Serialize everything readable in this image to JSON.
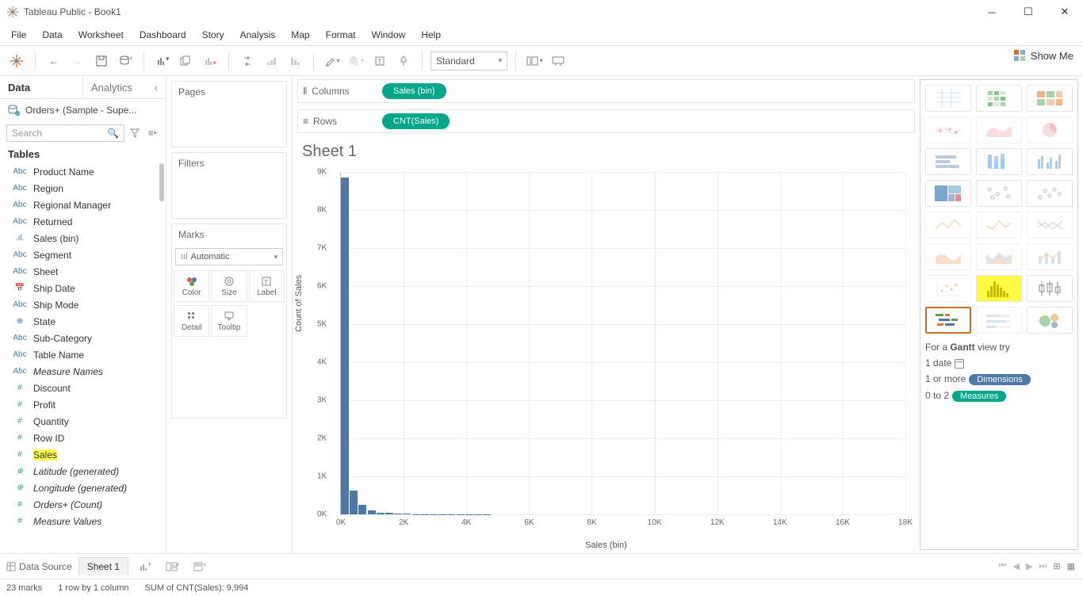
{
  "window": {
    "title": "Tableau Public - Book1"
  },
  "menu": [
    "File",
    "Data",
    "Worksheet",
    "Dashboard",
    "Story",
    "Analysis",
    "Map",
    "Format",
    "Window",
    "Help"
  ],
  "toolbar": {
    "fit": "Standard"
  },
  "show_me_label": "Show Me",
  "side_tabs": {
    "data": "Data",
    "analytics": "Analytics"
  },
  "datasource": "Orders+ (Sample - Supe...",
  "search_placeholder": "Search",
  "tables_label": "Tables",
  "fields": [
    {
      "icon": "Abc",
      "cls": "dim",
      "label": "Product Name"
    },
    {
      "icon": "Abc",
      "cls": "dim",
      "label": "Region"
    },
    {
      "icon": "Abc",
      "cls": "dim",
      "label": "Regional Manager"
    },
    {
      "icon": "Abc",
      "cls": "dim",
      "label": "Returned"
    },
    {
      "icon": ".ıl.",
      "cls": "dim",
      "label": "Sales (bin)"
    },
    {
      "icon": "Abc",
      "cls": "dim",
      "label": "Segment"
    },
    {
      "icon": "Abc",
      "cls": "dim",
      "label": "Sheet"
    },
    {
      "icon": "📅",
      "cls": "dim",
      "label": "Ship Date"
    },
    {
      "icon": "Abc",
      "cls": "dim",
      "label": "Ship Mode"
    },
    {
      "icon": "⊕",
      "cls": "dim",
      "label": "State"
    },
    {
      "icon": "Abc",
      "cls": "dim",
      "label": "Sub-Category"
    },
    {
      "icon": "Abc",
      "cls": "dim",
      "label": "Table Name"
    },
    {
      "icon": "Abc",
      "cls": "dim",
      "label": "Measure Names",
      "italic": true
    },
    {
      "icon": "#",
      "cls": "meas",
      "label": "Discount"
    },
    {
      "icon": "#",
      "cls": "meas",
      "label": "Profit"
    },
    {
      "icon": "#",
      "cls": "meas",
      "label": "Quantity"
    },
    {
      "icon": "#",
      "cls": "meas",
      "label": "Row ID"
    },
    {
      "icon": "#",
      "cls": "meas",
      "label": "Sales",
      "hl": true
    },
    {
      "icon": "⊕",
      "cls": "meas",
      "label": "Latitude (generated)",
      "italic": true
    },
    {
      "icon": "⊕",
      "cls": "meas",
      "label": "Longitude (generated)",
      "italic": true
    },
    {
      "icon": "#",
      "cls": "meas",
      "label": "Orders+ (Count)",
      "italic": true
    },
    {
      "icon": "#",
      "cls": "meas",
      "label": "Measure Values",
      "italic": true
    }
  ],
  "shelves": {
    "pages": "Pages",
    "filters": "Filters",
    "marks": "Marks",
    "marks_type": "Automatic",
    "cells": [
      "Color",
      "Size",
      "Label",
      "Detail",
      "Tooltip"
    ]
  },
  "drops": {
    "columns": "Columns",
    "rows": "Rows",
    "col_pill": "Sales (bin)",
    "row_pill": "CNT(Sales)"
  },
  "sheet_title": "Sheet 1",
  "chart_data": {
    "type": "bar",
    "title": "Sheet 1",
    "xlabel": "Sales (bin)",
    "ylabel": "Count of Sales",
    "ylim": [
      0,
      9000
    ],
    "xlim": [
      0,
      18000
    ],
    "yticks": [
      0,
      1000,
      2000,
      3000,
      4000,
      5000,
      6000,
      7000,
      8000,
      9000
    ],
    "ytick_labels": [
      "0K",
      "1K",
      "2K",
      "3K",
      "4K",
      "5K",
      "6K",
      "7K",
      "8K",
      "9K"
    ],
    "xticks": [
      0,
      2000,
      4000,
      6000,
      8000,
      10000,
      12000,
      14000,
      16000,
      18000
    ],
    "xtick_labels": [
      "0K",
      "2K",
      "4K",
      "6K",
      "8K",
      "10K",
      "12K",
      "14K",
      "16K",
      "18K"
    ],
    "bin_width": 283,
    "categories_x": [
      0,
      283,
      566,
      849,
      1132,
      1415,
      1698,
      1981,
      2264,
      2547,
      2830,
      3113,
      3396,
      3679,
      3962,
      4245,
      4528,
      4811,
      5094,
      5377,
      5660,
      5943,
      6226
    ],
    "values": [
      8850,
      620,
      260,
      100,
      50,
      35,
      20,
      12,
      10,
      8,
      6,
      5,
      4,
      3,
      2,
      2,
      2,
      1,
      1,
      1,
      1,
      1,
      0
    ]
  },
  "showme": {
    "hint_prefix": "For a ",
    "hint_type": "Gantt",
    "hint_suffix": " view try",
    "line1": "1 date",
    "line2": "1 or more",
    "line2_pill": "Dimensions",
    "line3": "0 to 2",
    "line3_pill": "Measures"
  },
  "bottom": {
    "datasource": "Data Source",
    "sheet": "Sheet 1"
  },
  "status": {
    "marks": "23 marks",
    "rowcol": "1 row by 1 column",
    "sum": "SUM of CNT(Sales): 9,994"
  }
}
